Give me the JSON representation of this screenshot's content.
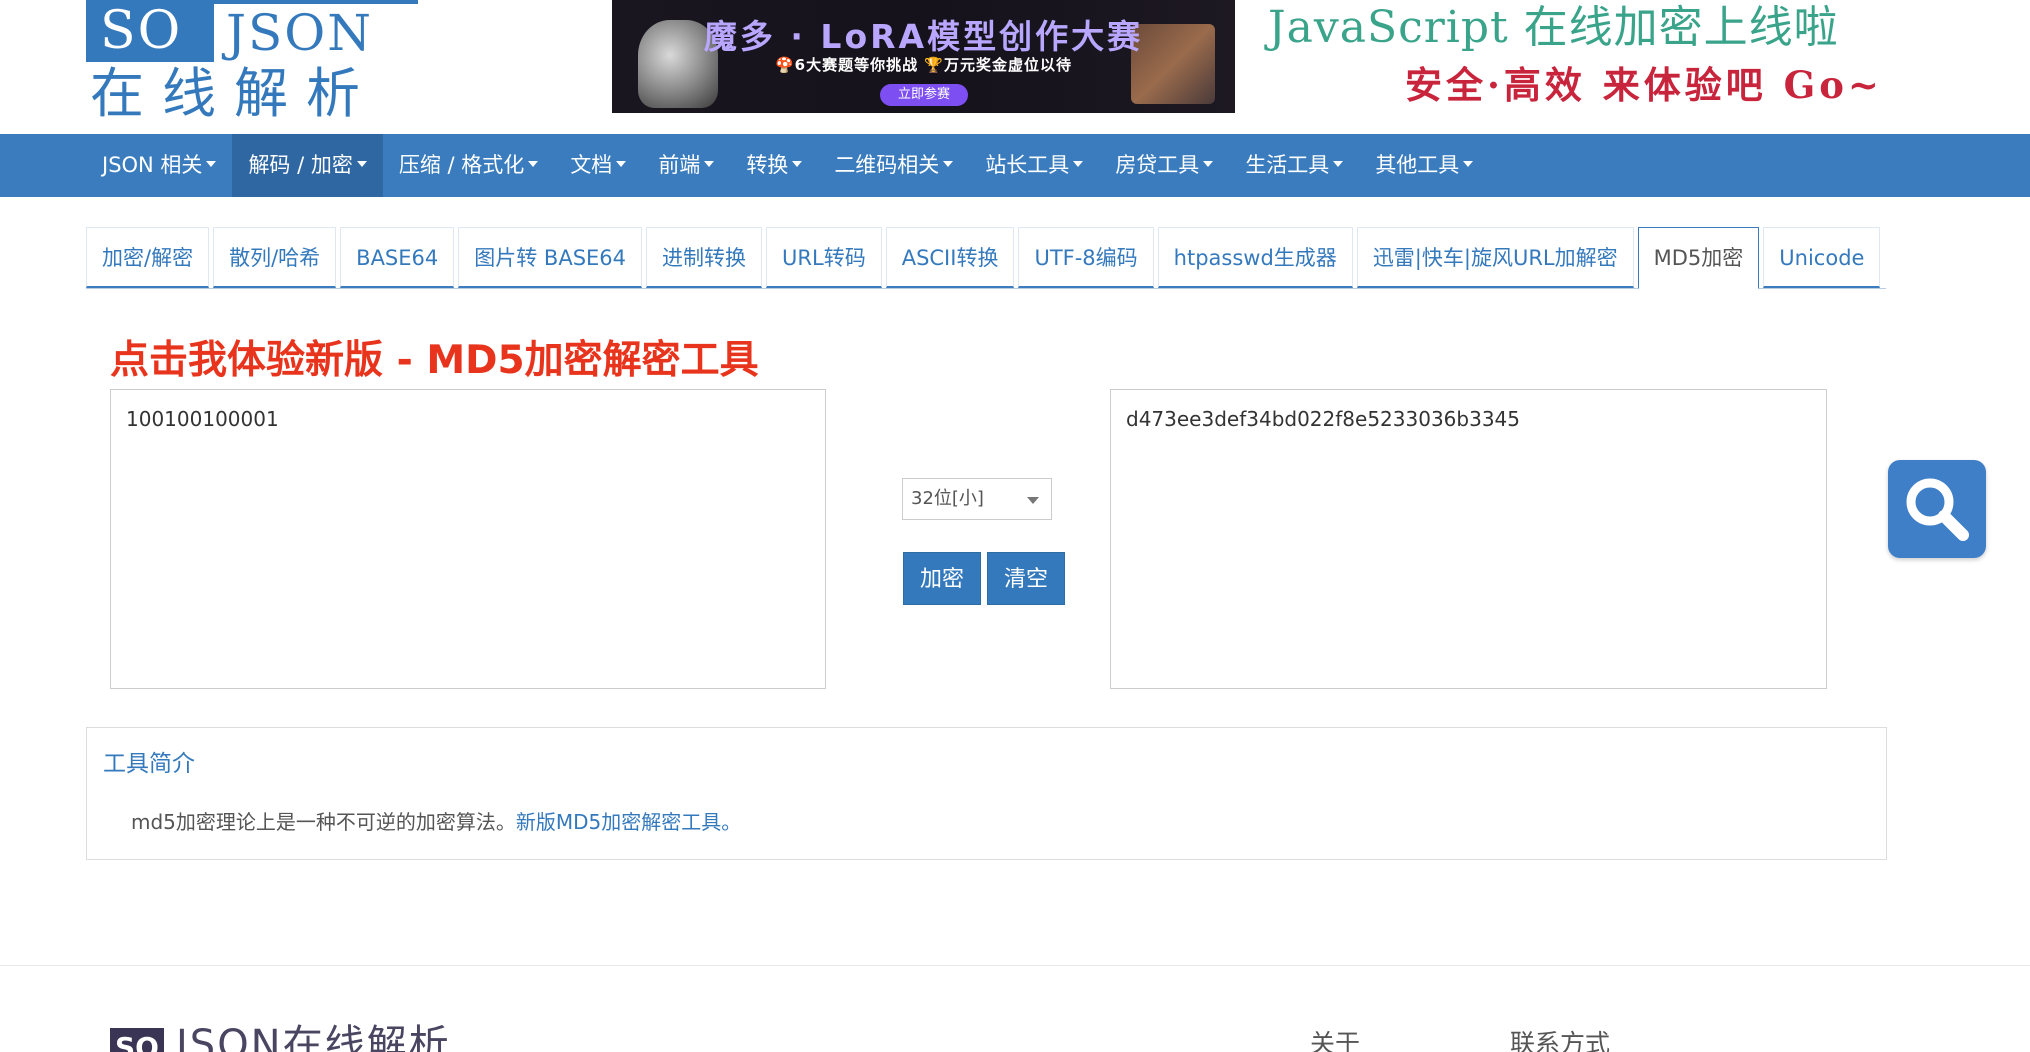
{
  "header": {
    "logo": {
      "so": "SO",
      "json": "JSON",
      "cn": "在线解析"
    },
    "banner": {
      "title": "魔多 · LoRA模型创作大赛",
      "subtitle": "🍄6大赛题等你挑战   🏆万元奖金虚位以待",
      "button": "立即参赛"
    },
    "slogan_line1": "JavaScript 在线加密上线啦",
    "slogan_line2": "安全·高效 来体验吧 Go~"
  },
  "nav": {
    "items": [
      {
        "label": "JSON 相关"
      },
      {
        "label": "解码 / 加密"
      },
      {
        "label": "压缩 / 格式化"
      },
      {
        "label": "文档"
      },
      {
        "label": "前端"
      },
      {
        "label": "转换"
      },
      {
        "label": "二维码相关"
      },
      {
        "label": "站长工具"
      },
      {
        "label": "房贷工具"
      },
      {
        "label": "生活工具"
      },
      {
        "label": "其他工具"
      }
    ],
    "active_index": 1
  },
  "tabs": {
    "items": [
      {
        "label": "加密/解密"
      },
      {
        "label": "散列/哈希"
      },
      {
        "label": "BASE64"
      },
      {
        "label": "图片转 BASE64"
      },
      {
        "label": "进制转换"
      },
      {
        "label": "URL转码"
      },
      {
        "label": "ASCII转换"
      },
      {
        "label": "UTF-8编码"
      },
      {
        "label": "htpasswd生成器"
      },
      {
        "label": "迅雷|快车|旋风URL加解密"
      },
      {
        "label": "MD5加密"
      },
      {
        "label": "Unicode"
      }
    ],
    "active_index": 10
  },
  "main": {
    "promo_title": "点击我体验新版 - MD5加密解密工具",
    "input_value": "100100100001",
    "output_value": "d473ee3def34bd022f8e5233036b3345",
    "select_value": "32位[小]",
    "encrypt_label": "加密",
    "clear_label": "清空"
  },
  "intro": {
    "title": "工具简介",
    "text": "md5加密理论上是一种不可逆的加密算法。",
    "link": "新版MD5加密解密工具。"
  },
  "footer": {
    "logo_box": "SO",
    "logo_text": "JSON在线解析",
    "about": "关于",
    "contact": "联系方式"
  },
  "colors": {
    "brand_blue": "#3a7cbe",
    "promo_red": "#e8341c",
    "slogan_green": "#3aa48b",
    "slogan_red": "#c8243c"
  }
}
